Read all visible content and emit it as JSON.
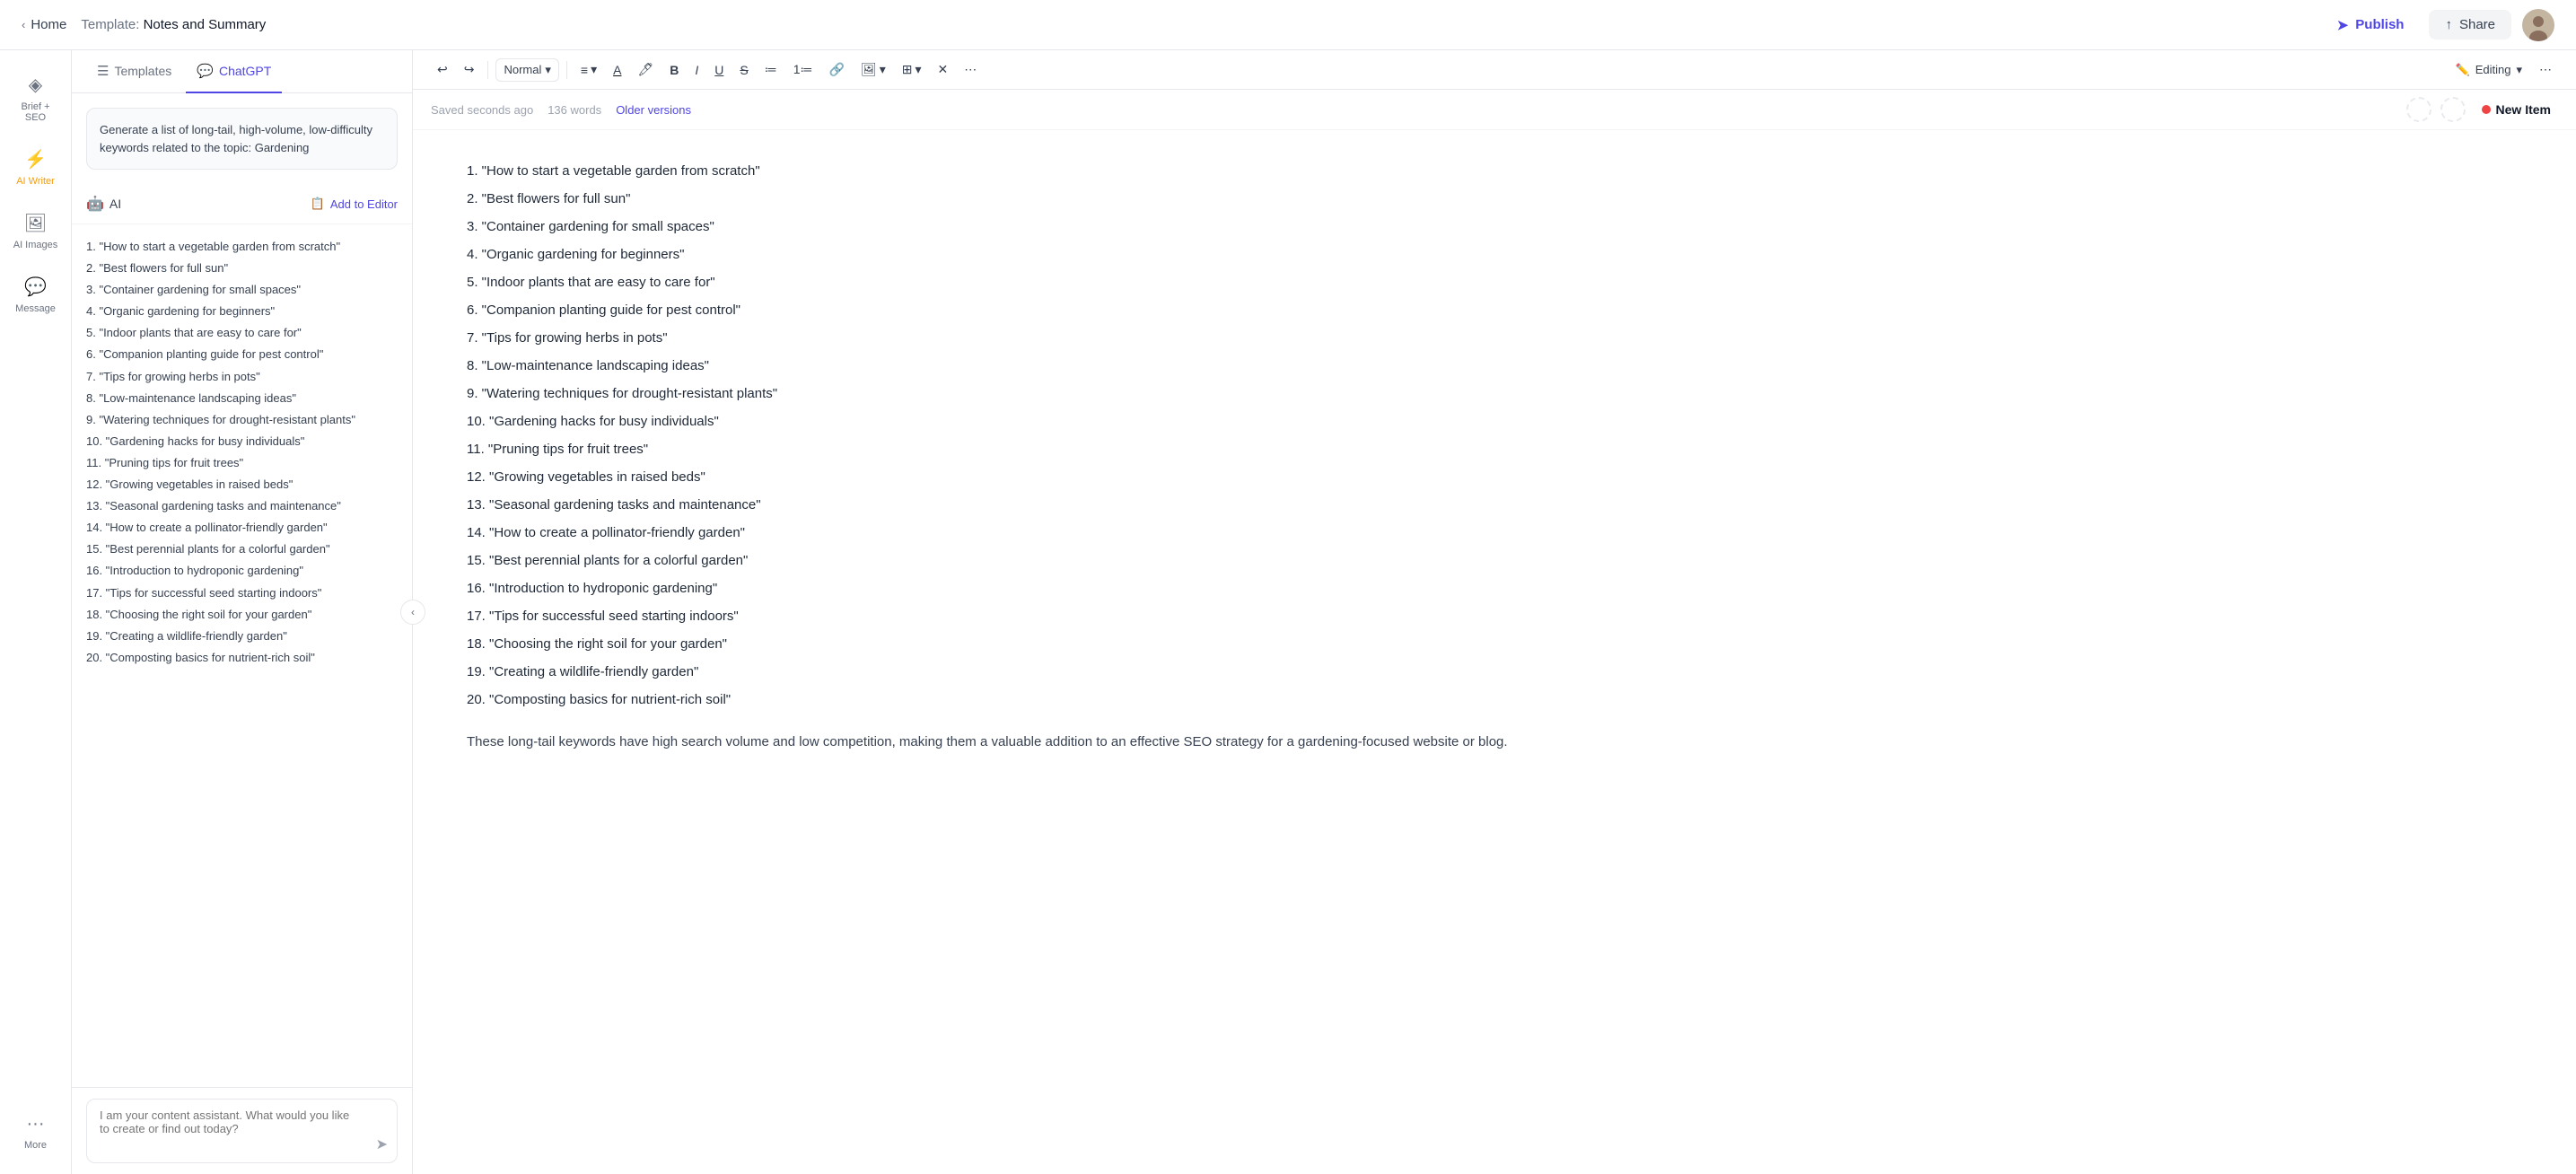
{
  "topbar": {
    "home_label": "Home",
    "template_prefix": "Template: ",
    "template_name": "Notes and Summary",
    "publish_label": "Publish",
    "share_label": "Share"
  },
  "sidebar": {
    "items": [
      {
        "id": "brief-seo",
        "icon": "◈",
        "label": "Brief + SEO",
        "active": false
      },
      {
        "id": "ai-writer",
        "icon": "⚡",
        "label": "AI Writer",
        "active": true
      },
      {
        "id": "ai-images",
        "icon": "🖼",
        "label": "AI Images",
        "active": false
      },
      {
        "id": "message",
        "icon": "💬",
        "label": "Message",
        "active": false
      },
      {
        "id": "more",
        "icon": "···",
        "label": "More",
        "active": false
      }
    ]
  },
  "panel": {
    "tabs": [
      {
        "id": "templates",
        "icon": "☰",
        "label": "Templates",
        "active": false
      },
      {
        "id": "chatgpt",
        "icon": "💬",
        "label": "ChatGPT",
        "active": true
      }
    ],
    "prompt": {
      "text": "Generate a list of long-tail, high-volume, low-difficulty keywords related to the topic: Gardening"
    },
    "ai_response": {
      "label": "AI",
      "add_to_editor_label": "Add to Editor",
      "items": [
        "\"How to start a vegetable garden from scratch\"",
        "\"Best flowers for full sun\"",
        "\"Container gardening for small spaces\"",
        "\"Organic gardening for beginners\"",
        "\"Indoor plants that are easy to care for\"",
        "\"Companion planting guide for pest control\"",
        "\"Tips for growing herbs in pots\"",
        "\"Low-maintenance landscaping ideas\"",
        "\"Watering techniques for drought-resistant plants\"",
        "\"Gardening hacks for busy individuals\"",
        "\"Pruning tips for fruit trees\"",
        "\"Growing vegetables in raised beds\"",
        "\"Seasonal gardening tasks and maintenance\"",
        "\"How to create a pollinator-friendly garden\"",
        "\"Best perennial plants for a colorful garden\"",
        "\"Introduction to hydroponic gardening\"",
        "\"Tips for successful seed starting indoors\"",
        "\"Choosing the right soil for your garden\"",
        "\"Creating a wildlife-friendly garden\"",
        "\"Composting basics for nutrient-rich soil\""
      ]
    },
    "chat_input": {
      "placeholder": "I am your content assistant. What would you like to create or find out today?"
    }
  },
  "editor": {
    "meta": {
      "saved_label": "Saved seconds ago",
      "word_count": "136 words",
      "older_versions_label": "Older versions",
      "new_item_label": "New Item",
      "editing_label": "Editing"
    },
    "toolbar": {
      "style_label": "Normal",
      "undo": "↩",
      "redo": "↪"
    },
    "content": {
      "items": [
        "\"How to start a vegetable garden from scratch\"",
        "\"Best flowers for full sun\"",
        "\"Container gardening for small spaces\"",
        "\"Organic gardening for beginners\"",
        "\"Indoor plants that are easy to care for\"",
        "\"Companion planting guide for pest control\"",
        "\"Tips for growing herbs in pots\"",
        "\"Low-maintenance landscaping ideas\"",
        "\"Watering techniques for drought-resistant plants\"",
        "\"Gardening hacks for busy individuals\"",
        "\"Pruning tips for fruit trees\"",
        "\"Growing vegetables in raised beds\"",
        "\"Seasonal gardening tasks and maintenance\"",
        "\"How to create a pollinator-friendly garden\"",
        "\"Best perennial plants for a colorful garden\"",
        "\"Introduction to hydroponic gardening\"",
        "\"Tips for successful seed starting indoors\"",
        "\"Choosing the right soil for your garden\"",
        "\"Creating a wildlife-friendly garden\"",
        "\"Composting basics for nutrient-rich soil\""
      ],
      "summary": "These long-tail keywords have high search volume and low competition, making them a valuable addition to an effective SEO strategy for a gardening-focused website or blog."
    }
  }
}
